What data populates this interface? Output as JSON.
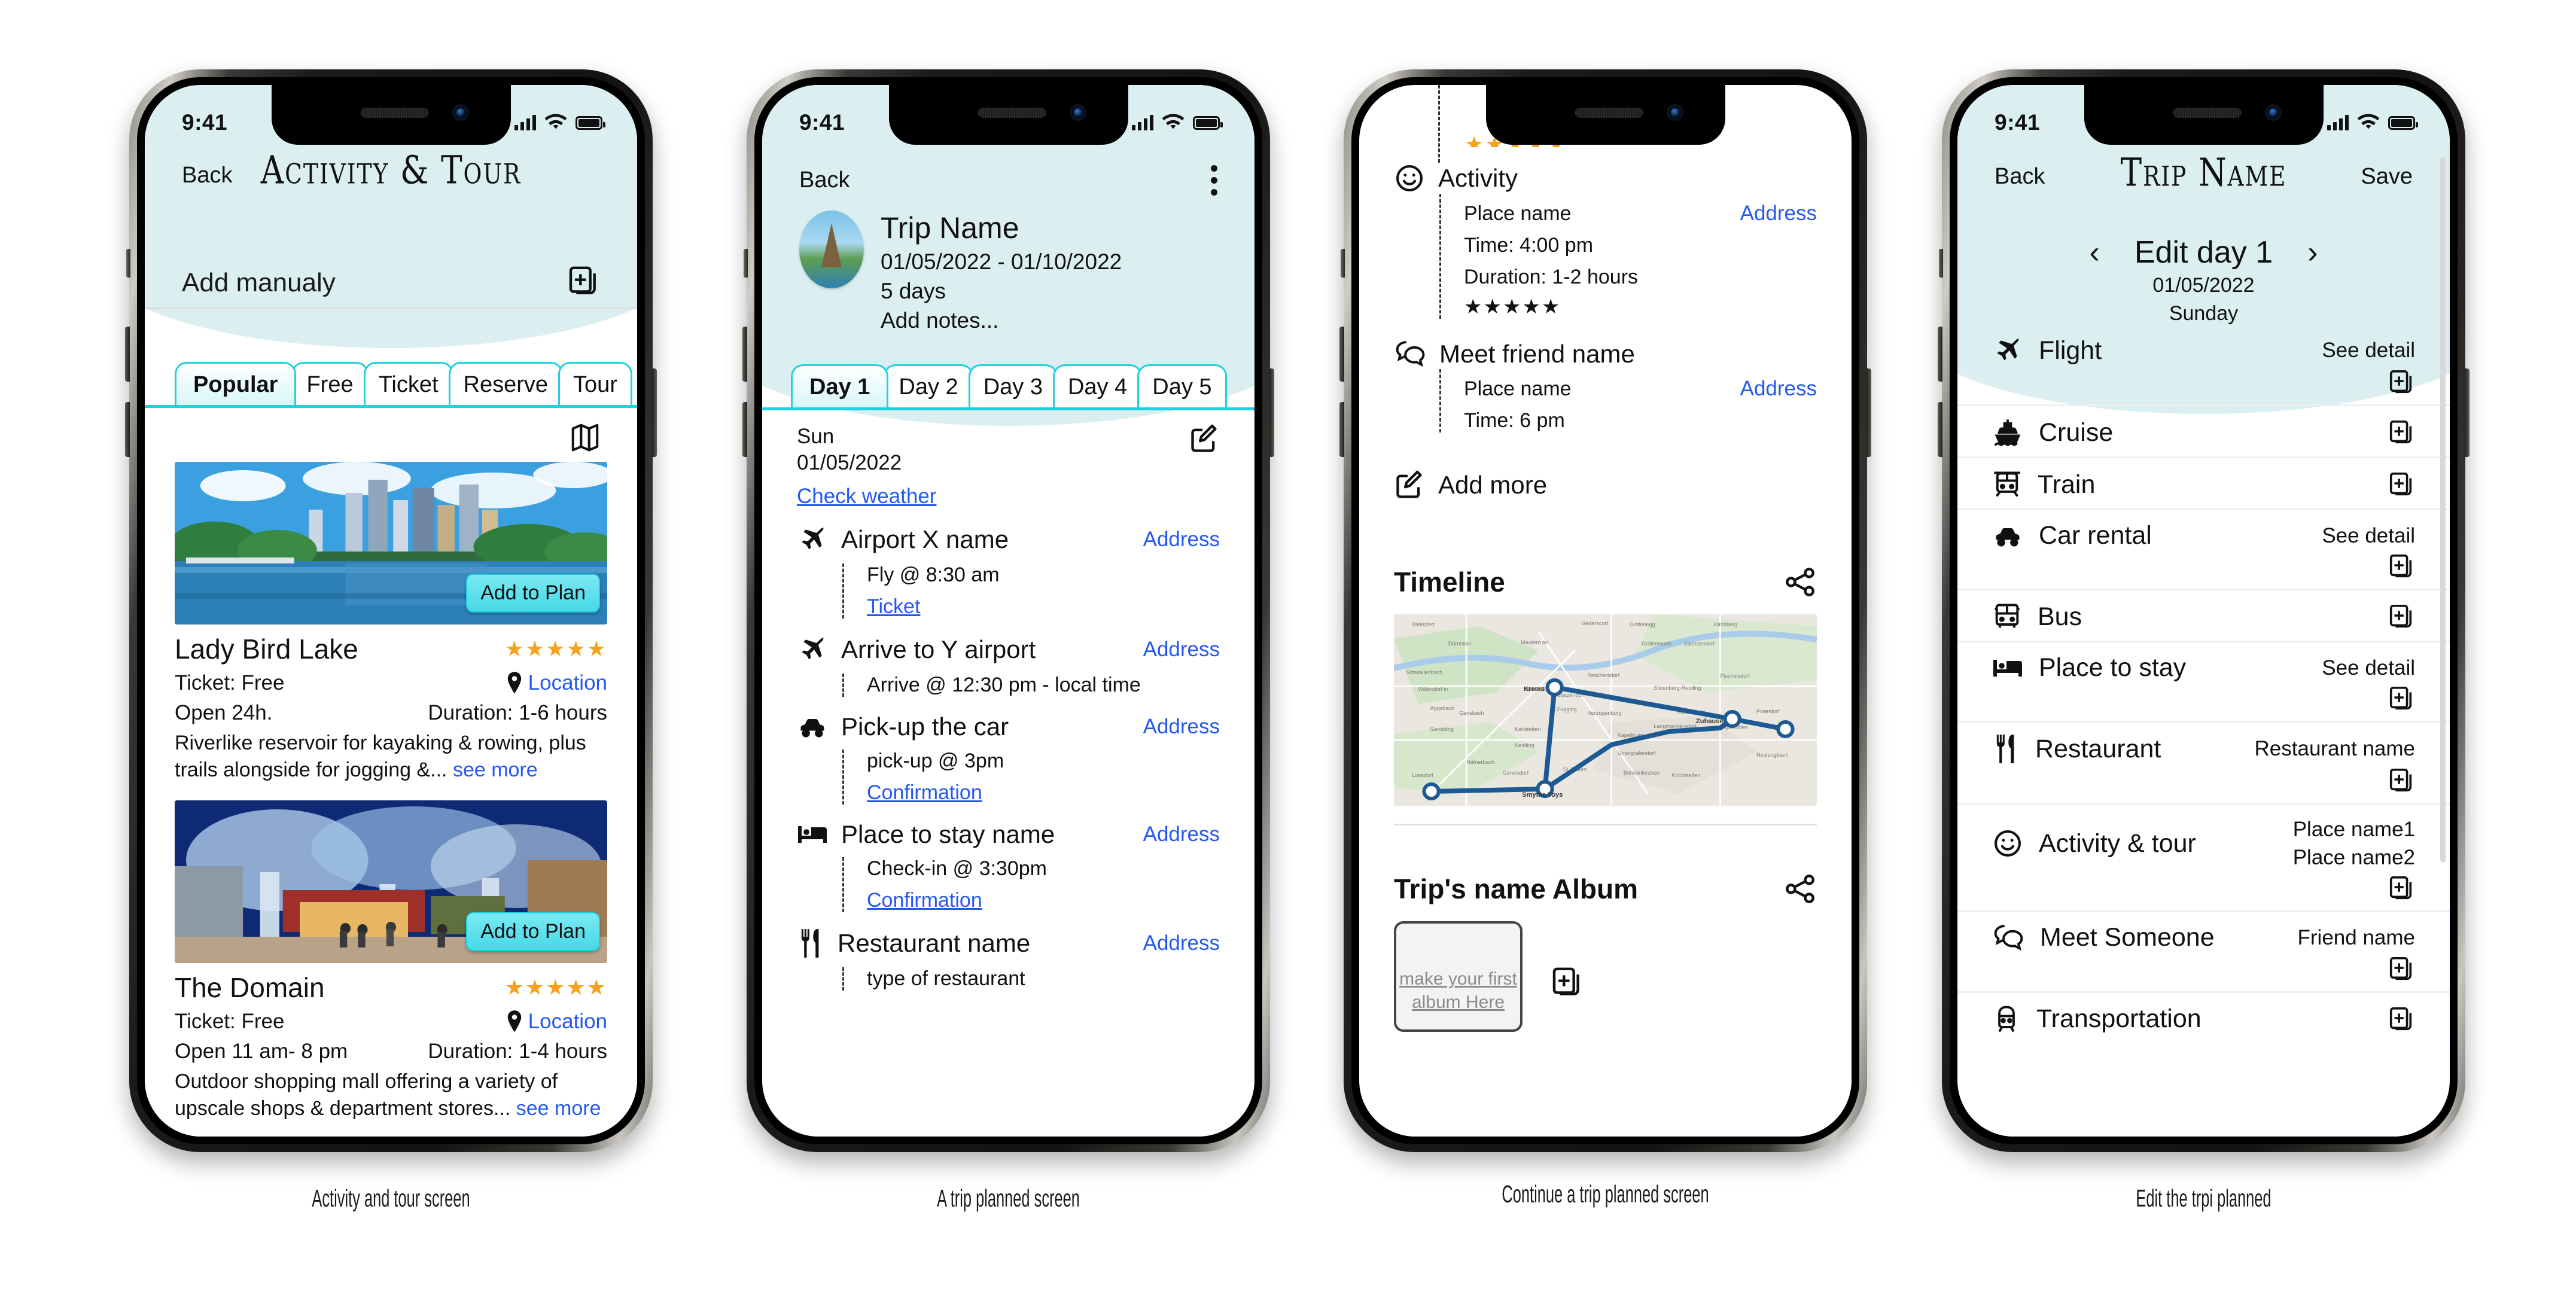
{
  "colors": {
    "mint": "#dceff0",
    "accent": "#23cfe0",
    "link": "#2558f0",
    "star": "#f6a21d",
    "cta": "#46d9e7"
  },
  "status": {
    "time": "9:41"
  },
  "phone1": {
    "caption": "Activity and tour screen",
    "nav": {
      "back": "Back",
      "title": "Activity & Tour"
    },
    "add_manually": {
      "label": "Add manualy"
    },
    "tabs": [
      {
        "label": "Popular",
        "active": true
      },
      {
        "label": "Free",
        "active": false
      },
      {
        "label": "Ticket",
        "active": false
      },
      {
        "label": "Reserve",
        "active": false
      },
      {
        "label": "Tour",
        "active": false
      }
    ],
    "cards": [
      {
        "title": "Lady Bird Lake",
        "cta": "Add to Plan",
        "rating": "★★★★★",
        "ticket": "Ticket: Free",
        "location": "Location",
        "open": "Open 24h.",
        "duration": "Duration: 1-6 hours",
        "desc": "Riverlike reservoir for kayaking & rowing, plus trails alongside for jogging &...",
        "see_more": "see more"
      },
      {
        "title": "The Domain",
        "cta": "Add to Plan",
        "rating": "★★★★★",
        "ticket": "Ticket: Free",
        "location": "Location",
        "open": "Open 11 am- 8 pm",
        "duration": "Duration: 1-4 hours",
        "desc": "Outdoor shopping mall offering a variety of upscale shops & department stores...",
        "see_more": "see more"
      }
    ]
  },
  "phone2": {
    "caption": "A trip planned screen",
    "nav": {
      "back": "Back"
    },
    "trip": {
      "name": "Trip Name",
      "dates": "01/05/2022 - 01/10/2022",
      "length": "5 days",
      "notes": "Add notes..."
    },
    "day_tabs": [
      {
        "label": "Day 1",
        "active": true
      },
      {
        "label": "Day 2",
        "active": false
      },
      {
        "label": "Day 3",
        "active": false
      },
      {
        "label": "Day 4",
        "active": false
      },
      {
        "label": "Day 5",
        "active": false
      }
    ],
    "day": {
      "weekday": "Sun",
      "date": "01/05/2022",
      "weather_link": "Check weather"
    },
    "items": [
      {
        "icon": "plane-icon",
        "title": "Airport X name",
        "addr": "Address",
        "time": "Fly @ 8:30 am",
        "link": "Ticket"
      },
      {
        "icon": "plane-icon",
        "title": "Arrive to Y airport",
        "addr": "Address",
        "time": "Arrive @ 12:30 pm - local time",
        "link": ""
      },
      {
        "icon": "car-icon",
        "title": "Pick-up the car",
        "addr": "Address",
        "time": "pick-up @ 3pm",
        "link": "Confirmation"
      },
      {
        "icon": "bed-icon",
        "title": "Place to stay name",
        "addr": "Address",
        "time": "Check-in @ 3:30pm",
        "link": "Confirmation"
      },
      {
        "icon": "restaurant-icon",
        "title": "Restaurant name",
        "addr": "Address",
        "time": "type of restaurant",
        "link": ""
      }
    ]
  },
  "phone3": {
    "caption": "Continue a trip planned screen",
    "items": [
      {
        "icon": "smiley-icon",
        "title": "Activity",
        "place": "Place name",
        "addr": "Address",
        "time": "Time: 4:00 pm",
        "duration": "Duration: 1-2 hours",
        "rating": "★★★★★"
      },
      {
        "icon": "chat-icon",
        "title": "Meet friend name",
        "place": "Place name",
        "addr": "Address",
        "time": "Time: 6 pm",
        "duration": "",
        "rating": ""
      }
    ],
    "add_more": "Add more",
    "timeline": {
      "title": "Timeline"
    },
    "album": {
      "title": "Trip's name Album",
      "placeholder": "make your first album Here"
    }
  },
  "phone4": {
    "caption": "Edit the trpi planned",
    "nav": {
      "back": "Back",
      "title": "Trip Name",
      "save": "Save"
    },
    "daynav": {
      "title": "Edit day 1",
      "date": "01/05/2022",
      "weekday": "Sunday"
    },
    "rows": [
      {
        "icon": "plane-icon",
        "label": "Flight",
        "value": "See detail"
      },
      {
        "icon": "cruise-icon",
        "label": "Cruise",
        "value": ""
      },
      {
        "icon": "train-icon",
        "label": "Train",
        "value": ""
      },
      {
        "icon": "car-icon",
        "label": "Car rental",
        "value": "See detail"
      },
      {
        "icon": "bus-icon",
        "label": "Bus",
        "value": ""
      },
      {
        "icon": "bed-icon",
        "label": "Place to stay",
        "value": "See detail"
      },
      {
        "icon": "restaurant-icon",
        "label": "Restaurant",
        "value": "Restaurant name"
      },
      {
        "icon": "smiley-icon",
        "label": "Activity & tour",
        "value": "Place name1\nPlace name2"
      },
      {
        "icon": "chat-icon",
        "label": "Meet Someone",
        "value": "Friend name"
      },
      {
        "icon": "transport-icon",
        "label": "Transportation",
        "value": ""
      }
    ]
  }
}
